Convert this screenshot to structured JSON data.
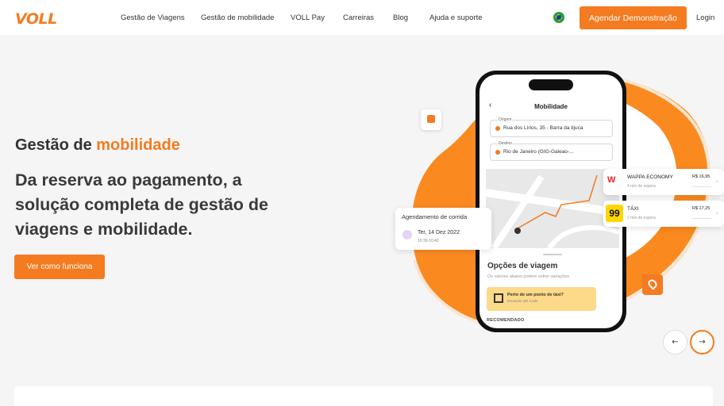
{
  "header": {
    "logo": "VOLL",
    "nav": [
      {
        "label": "Gestão de Viagens"
      },
      {
        "label": "Gestão de mobilidade"
      },
      {
        "label": "VOLL Pay"
      },
      {
        "label": "Carreiras"
      },
      {
        "label": "Blog"
      },
      {
        "label": "Ajuda e suporte"
      }
    ],
    "flag_icon": "brazil-flag-icon",
    "cta_label": "Agendar Demonstração",
    "login_label": "Login"
  },
  "hero": {
    "eyebrow_prefix": "Gestão de ",
    "eyebrow_accent": "mobilidade",
    "headline": "Da reserva ao pagamento, a solução completa de gestão de viagens e mobilidade.",
    "button_label": "Ver como funciona"
  },
  "phone": {
    "title": "Mobilidade",
    "origin_label": "Origem",
    "origin_value": "Rua dos Lírios, 35 - Barra da tijuca",
    "destination_label": "Destino",
    "destination_value": "Rio de Janeiro (GIG-Galeao-...",
    "options_title": "Opções de viagem",
    "options_subtitle": "Os valores abaixo podem sofrer variações",
    "promo_title": "Perto de um ponto de táxi?",
    "promo_subtitle": "Escaneie QR Code",
    "recommended": "RECOMENDADO"
  },
  "schedule_card": {
    "title": "Agendamento de corrida",
    "date": "Ter, 14 Dez 2022",
    "time": "10:30-10:40"
  },
  "rides": [
    {
      "name": "WAPPA ECONOMY",
      "wait": "4 min de espera",
      "price": "R$ 16,95",
      "logo": "W"
    },
    {
      "name": "TÁXI",
      "wait": "2 min de espera",
      "price": "R$ 17,25",
      "logo": "99"
    }
  ],
  "colors": {
    "accent": "#f47b20",
    "background": "#f5f5f5"
  },
  "carousel": {
    "prev_icon": "←",
    "next_icon": "→"
  }
}
